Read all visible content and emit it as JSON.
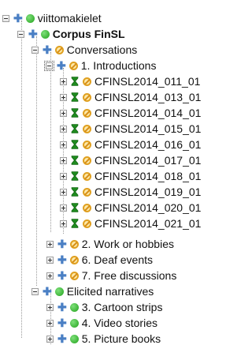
{
  "tree": {
    "root": {
      "label": "viittomakielet",
      "status": "green"
    },
    "corpus": {
      "label": "Corpus FinSL",
      "status": "green"
    },
    "conversations": {
      "label": "Conversations",
      "status": "na",
      "introductions": {
        "label": "1. Introductions",
        "status": "na",
        "sessions": [
          {
            "label": "CFINSL2014_011_01"
          },
          {
            "label": "CFINSL2014_013_01"
          },
          {
            "label": "CFINSL2014_014_01"
          },
          {
            "label": "CFINSL2014_015_01"
          },
          {
            "label": "CFINSL2014_016_01"
          },
          {
            "label": "CFINSL2014_017_01"
          },
          {
            "label": "CFINSL2014_018_01"
          },
          {
            "label": "CFINSL2014_019_01"
          },
          {
            "label": "CFINSL2014_020_01"
          },
          {
            "label": "CFINSL2014_021_01"
          }
        ]
      },
      "others": [
        {
          "label": "2. Work or hobbies",
          "status": "na"
        },
        {
          "label": "6. Deaf events",
          "status": "na"
        },
        {
          "label": "7. Free discussions",
          "status": "na"
        }
      ]
    },
    "elicited": {
      "label": "Elicited narratives",
      "status": "green",
      "children": [
        {
          "label": "3. Cartoon strips",
          "status": "green"
        },
        {
          "label": "4. Video stories",
          "status": "green"
        },
        {
          "label": "5. Picture books",
          "status": "green"
        }
      ]
    }
  },
  "icons": {
    "add": "plus-cross",
    "ok_status": "green-dot",
    "na_status": "prohibited-circle",
    "pending": "hourglass"
  },
  "colors": {
    "add_icon": "#4a7fc4",
    "ok_status": "#22a21c",
    "na_status": "#e0a020",
    "hourglass": "#1f8a1f"
  }
}
